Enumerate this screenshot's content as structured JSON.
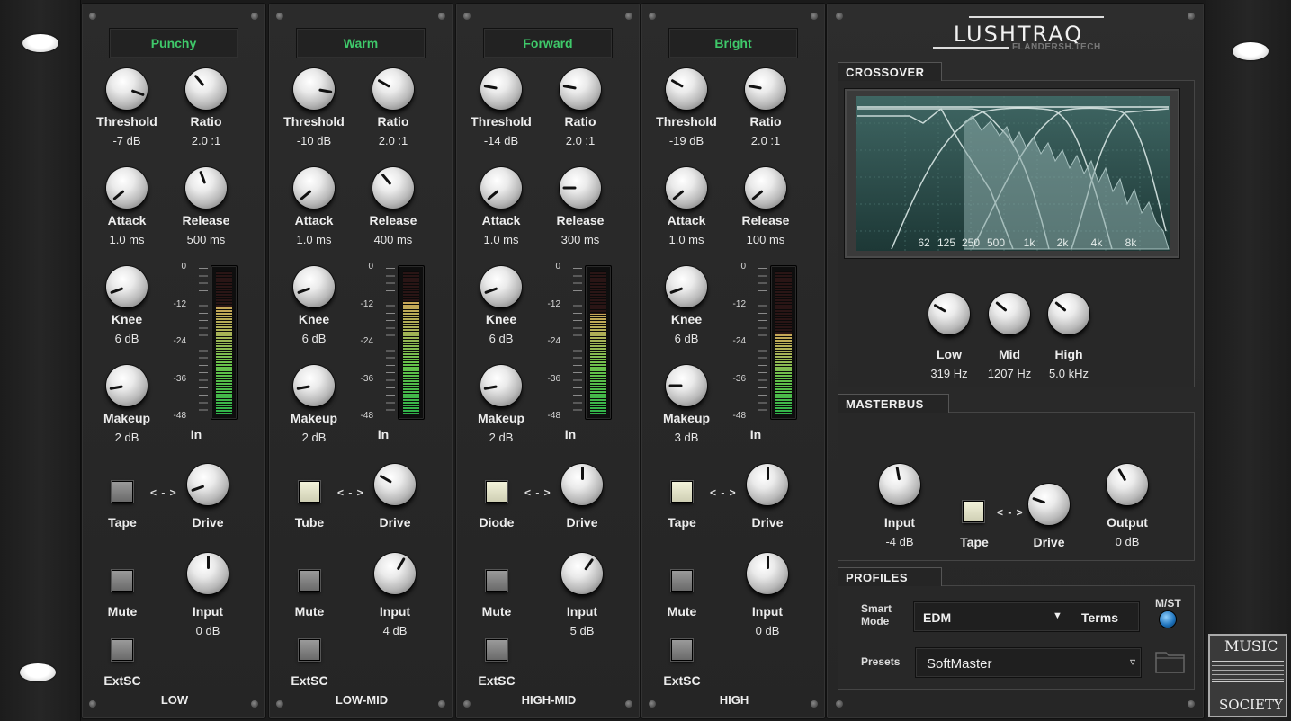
{
  "bands": [
    {
      "name": "LOW",
      "character": "Punchy",
      "threshold": {
        "label": "Threshold",
        "value": "-7 dB",
        "angle": 110
      },
      "ratio": {
        "label": "Ratio",
        "value": "2.0 :1",
        "angle": -40
      },
      "attack": {
        "label": "Attack",
        "value": "1.0 ms",
        "angle": -130
      },
      "release": {
        "label": "Release",
        "value": "500 ms",
        "angle": -20
      },
      "knee": {
        "label": "Knee",
        "value": "6 dB",
        "angle": -110
      },
      "makeup": {
        "label": "Makeup",
        "value": "2 dB",
        "angle": -100
      },
      "meter": {
        "label": "In",
        "level": 0.75
      },
      "sat_mode": {
        "label": "Tape",
        "on": false
      },
      "drive": {
        "label": "Drive",
        "angle": -110
      },
      "mute": {
        "label": "Mute"
      },
      "input": {
        "label": "Input",
        "value": "0 dB",
        "angle": 0
      },
      "extsc": {
        "label": "ExtSC"
      }
    },
    {
      "name": "LOW-MID",
      "character": "Warm",
      "threshold": {
        "label": "Threshold",
        "value": "-10 dB",
        "angle": 100
      },
      "ratio": {
        "label": "Ratio",
        "value": "2.0 :1",
        "angle": -60
      },
      "attack": {
        "label": "Attack",
        "value": "1.0 ms",
        "angle": -130
      },
      "release": {
        "label": "Release",
        "value": "400 ms",
        "angle": -40
      },
      "knee": {
        "label": "Knee",
        "value": "6 dB",
        "angle": -110
      },
      "makeup": {
        "label": "Makeup",
        "value": "2 dB",
        "angle": -100
      },
      "meter": {
        "label": "In",
        "level": 0.78
      },
      "sat_mode": {
        "label": "Tube",
        "on": true
      },
      "drive": {
        "label": "Drive",
        "angle": -60
      },
      "mute": {
        "label": "Mute"
      },
      "input": {
        "label": "Input",
        "value": "4 dB",
        "angle": 30
      },
      "extsc": {
        "label": "ExtSC"
      }
    },
    {
      "name": "HIGH-MID",
      "character": "Forward",
      "threshold": {
        "label": "Threshold",
        "value": "-14 dB",
        "angle": -80
      },
      "ratio": {
        "label": "Ratio",
        "value": "2.0 :1",
        "angle": -80
      },
      "attack": {
        "label": "Attack",
        "value": "1.0 ms",
        "angle": -130
      },
      "release": {
        "label": "Release",
        "value": "300 ms",
        "angle": -90
      },
      "knee": {
        "label": "Knee",
        "value": "6 dB",
        "angle": -110
      },
      "makeup": {
        "label": "Makeup",
        "value": "2 dB",
        "angle": -100
      },
      "meter": {
        "label": "In",
        "level": 0.7
      },
      "sat_mode": {
        "label": "Diode",
        "on": true
      },
      "drive": {
        "label": "Drive",
        "angle": 0
      },
      "mute": {
        "label": "Mute"
      },
      "input": {
        "label": "Input",
        "value": "5 dB",
        "angle": 35
      },
      "extsc": {
        "label": "ExtSC"
      }
    },
    {
      "name": "HIGH",
      "character": "Bright",
      "threshold": {
        "label": "Threshold",
        "value": "-19 dB",
        "angle": -60
      },
      "ratio": {
        "label": "Ratio",
        "value": "2.0 :1",
        "angle": -80
      },
      "attack": {
        "label": "Attack",
        "value": "1.0 ms",
        "angle": -130
      },
      "release": {
        "label": "Release",
        "value": "100 ms",
        "angle": -130
      },
      "knee": {
        "label": "Knee",
        "value": "6 dB",
        "angle": -110
      },
      "makeup": {
        "label": "Makeup",
        "value": "3 dB",
        "angle": -90
      },
      "meter": {
        "label": "In",
        "level": 0.56
      },
      "sat_mode": {
        "label": "Tape",
        "on": true
      },
      "drive": {
        "label": "Drive",
        "angle": 0
      },
      "mute": {
        "label": "Mute"
      },
      "input": {
        "label": "Input",
        "value": "0 dB",
        "angle": 0
      },
      "extsc": {
        "label": "ExtSC"
      }
    }
  ],
  "meter_scale": [
    "0",
    "-12",
    "-24",
    "-36",
    "-48"
  ],
  "link_symbol": "< - >",
  "logo": {
    "title": "LUSHTRAQ",
    "subtitle": "FLANDERSH.TECH"
  },
  "crossover": {
    "title": "CROSSOVER",
    "freq_labels": [
      "62",
      "125",
      "250",
      "500",
      "1k",
      "2k",
      "4k",
      "8k"
    ],
    "knobs": [
      {
        "label": "Low",
        "value": "319 Hz",
        "angle": -60
      },
      {
        "label": "Mid",
        "value": "1207 Hz",
        "angle": -50
      },
      {
        "label": "High",
        "value": "5.0 kHz",
        "angle": -50
      }
    ]
  },
  "masterbus": {
    "title": "MASTERBUS",
    "input": {
      "label": "Input",
      "value": "-4 dB",
      "angle": -10
    },
    "sat_mode": {
      "label": "Tape",
      "on": true
    },
    "drive": {
      "label": "Drive",
      "angle": -70
    },
    "output": {
      "label": "Output",
      "value": "0 dB",
      "angle": -30
    }
  },
  "profiles": {
    "title": "PROFILES",
    "smart_mode_label": "Smart\nMode",
    "smart_mode_value": "EDM",
    "terms_label": "Terms",
    "mst_label": "M/ST",
    "presets_label": "Presets",
    "presets_value": "SoftMaster"
  },
  "watermark": {
    "line1": "MUSIC",
    "line2": "SOCIETY"
  },
  "colors": {
    "preset_text": "#3fc96a",
    "screen_bg": "#2a4a48",
    "led": "#1b6fb8"
  }
}
